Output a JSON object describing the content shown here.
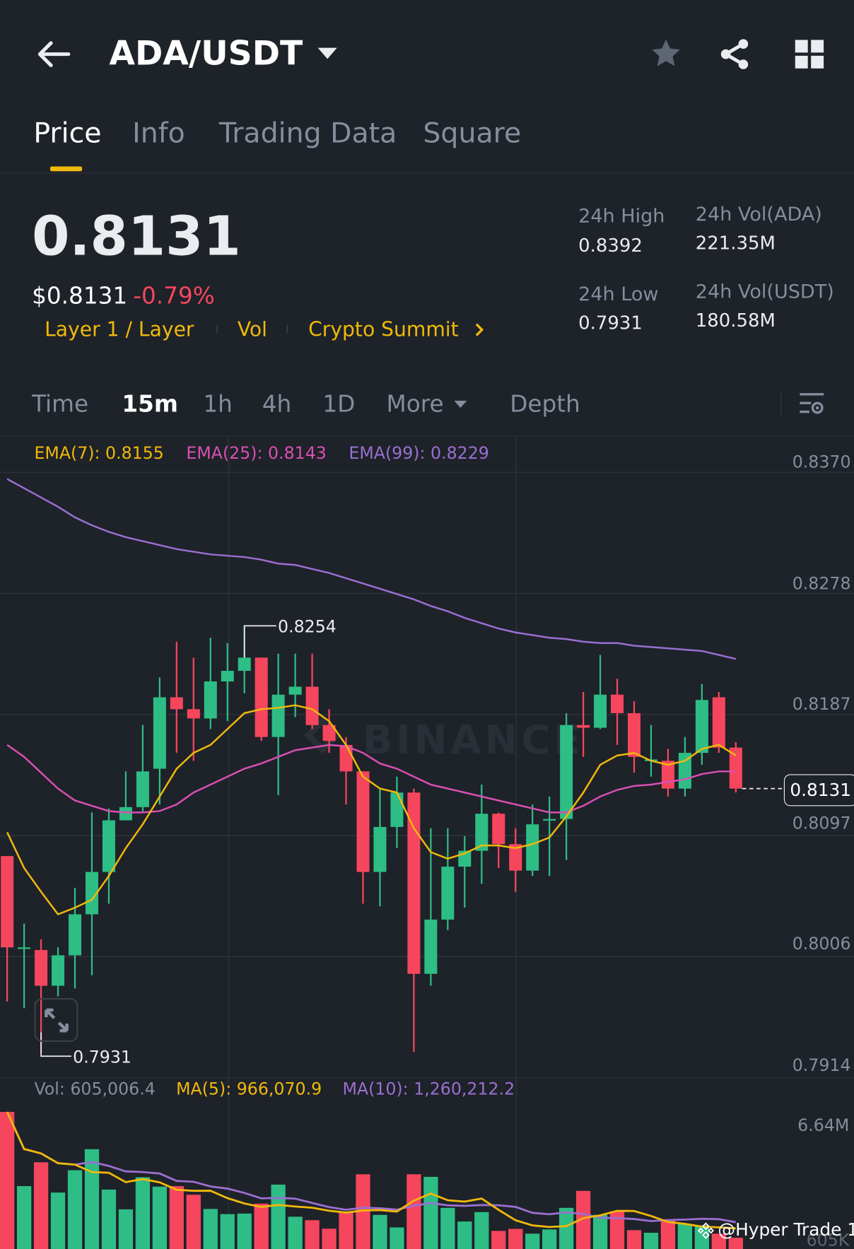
{
  "header": {
    "pair": "ADA/USDT",
    "icons": [
      "back-arrow-icon",
      "caret-down-icon",
      "star-icon",
      "share-icon",
      "grid-icon"
    ]
  },
  "tabs": [
    {
      "label": "Price",
      "active": true
    },
    {
      "label": "Info"
    },
    {
      "label": "Trading Data"
    },
    {
      "label": "Square"
    }
  ],
  "price": {
    "last": "0.8131",
    "usd": "$0.8131",
    "change": "-0.79%"
  },
  "tags": [
    "Layer 1 / Layer",
    "Vol",
    "Crypto Summit"
  ],
  "stats": {
    "high_label": "24h High",
    "high": "0.8392",
    "low_label": "24h Low",
    "low": "0.7931",
    "vol_ada_label": "24h Vol(ADA)",
    "vol_ada": "221.35M",
    "vol_usdt_label": "24h Vol(USDT)",
    "vol_usdt": "180.58M"
  },
  "intervals": {
    "time": "Time",
    "m15": "15m",
    "h1": "1h",
    "h4": "4h",
    "d1": "1D",
    "more": "More",
    "depth": "Depth",
    "selected": "15m"
  },
  "legend": {
    "ema7": "EMA(7): 0.8155",
    "ema25": "EMA(25): 0.8143",
    "ema99": "EMA(99): 0.8229"
  },
  "vol_legend": {
    "vol": "Vol: 605,006.4",
    "ma5": "MA(5): 966,070.9",
    "ma10": "MA(10): 1,260,212.2"
  },
  "colors": {
    "up": "#2ebd85",
    "down": "#f6465d",
    "ema7": "#f0b90b",
    "ema25": "#d94fb3",
    "ema99": "#9a6fd1",
    "accent": "#f0b90b"
  },
  "watermark": {
    "brand": "BINANCE",
    "credit": "@Hyper Trade 1"
  },
  "chart_data": {
    "type": "candlestick",
    "interval": "15m",
    "price_axis": {
      "ticks": [
        0.837,
        0.8278,
        0.8187,
        0.8097,
        0.8006,
        0.7914
      ],
      "labels": [
        "0.8370",
        "0.8278",
        "0.8187",
        "0.8097",
        "0.8006",
        "0.7914"
      ]
    },
    "current_price_label": "0.8131",
    "high_marker": "0.8254",
    "low_marker": "0.7931",
    "ohlc": [
      [
        0.808,
        0.808,
        0.797,
        0.8011
      ],
      [
        0.8011,
        0.8029,
        0.7965,
        0.8011
      ],
      [
        0.8009,
        0.8017,
        0.7931,
        0.7982
      ],
      [
        0.7982,
        0.8011,
        0.7974,
        0.8005
      ],
      [
        0.8005,
        0.8056,
        0.798,
        0.8036
      ],
      [
        0.8036,
        0.8113,
        0.799,
        0.8068
      ],
      [
        0.8068,
        0.8116,
        0.8044,
        0.8107
      ],
      [
        0.8107,
        0.8144,
        0.8107,
        0.8117
      ],
      [
        0.8117,
        0.8179,
        0.8113,
        0.8144
      ],
      [
        0.8146,
        0.8215,
        0.8119,
        0.82
      ],
      [
        0.82,
        0.8242,
        0.8158,
        0.8191
      ],
      [
        0.8191,
        0.823,
        0.8152,
        0.8184
      ],
      [
        0.8184,
        0.8245,
        0.8176,
        0.8212
      ],
      [
        0.8212,
        0.8241,
        0.8182,
        0.822
      ],
      [
        0.822,
        0.8254,
        0.8203,
        0.823
      ],
      [
        0.823,
        0.823,
        0.8167,
        0.817
      ],
      [
        0.817,
        0.8233,
        0.8126,
        0.8202
      ],
      [
        0.8202,
        0.8233,
        0.8185,
        0.8208
      ],
      [
        0.8208,
        0.8233,
        0.8176,
        0.8179
      ],
      [
        0.8179,
        0.8191,
        0.8158,
        0.8167
      ],
      [
        0.8164,
        0.817,
        0.8119,
        0.8144
      ],
      [
        0.8144,
        0.8144,
        0.8044,
        0.8068
      ],
      [
        0.8068,
        0.8131,
        0.8042,
        0.8102
      ],
      [
        0.8102,
        0.814,
        0.8086,
        0.8128
      ],
      [
        0.8128,
        0.8131,
        0.7932,
        0.7991
      ],
      [
        0.7991,
        0.8101,
        0.7982,
        0.8032
      ],
      [
        0.8032,
        0.8101,
        0.8024,
        0.8072
      ],
      [
        0.8072,
        0.8095,
        0.8041,
        0.8084
      ],
      [
        0.8084,
        0.8134,
        0.8059,
        0.8112
      ],
      [
        0.8112,
        0.8113,
        0.8071,
        0.8089
      ],
      [
        0.8089,
        0.8101,
        0.8053,
        0.8069
      ],
      [
        0.8069,
        0.8119,
        0.8065,
        0.8104
      ],
      [
        0.8107,
        0.8125,
        0.8065,
        0.8108
      ],
      [
        0.8108,
        0.8188,
        0.8077,
        0.8179
      ],
      [
        0.8179,
        0.8204,
        0.8155,
        0.8177
      ],
      [
        0.8177,
        0.8232,
        0.8176,
        0.8202
      ],
      [
        0.8202,
        0.8214,
        0.8164,
        0.8188
      ],
      [
        0.8188,
        0.8197,
        0.8143,
        0.8155
      ],
      [
        0.8152,
        0.8179,
        0.814,
        0.8153
      ],
      [
        0.8152,
        0.8161,
        0.8125,
        0.8131
      ],
      [
        0.8131,
        0.817,
        0.8125,
        0.8158
      ],
      [
        0.8158,
        0.821,
        0.8149,
        0.8198
      ],
      [
        0.82,
        0.8204,
        0.8158,
        0.8162
      ],
      [
        0.8162,
        0.8166,
        0.8128,
        0.8131
      ]
    ],
    "ema7": [
      0.8098,
      0.8071,
      0.8053,
      0.8036,
      0.8041,
      0.8047,
      0.8065,
      0.8086,
      0.8104,
      0.8125,
      0.8146,
      0.8158,
      0.8164,
      0.8176,
      0.8188,
      0.8191,
      0.8192,
      0.8194,
      0.8191,
      0.8182,
      0.8164,
      0.814,
      0.8131,
      0.8128,
      0.8101,
      0.8083,
      0.8078,
      0.8082,
      0.8088,
      0.8088,
      0.8086,
      0.8089,
      0.8094,
      0.811,
      0.8128,
      0.8149,
      0.8156,
      0.8158,
      0.8152,
      0.8149,
      0.8152,
      0.8161,
      0.8164,
      0.8156
    ],
    "ema25": [
      0.8164,
      0.8155,
      0.8143,
      0.8131,
      0.8122,
      0.8118,
      0.8114,
      0.8113,
      0.8113,
      0.8114,
      0.8119,
      0.8128,
      0.8134,
      0.814,
      0.8146,
      0.815,
      0.8155,
      0.816,
      0.8162,
      0.8164,
      0.8163,
      0.8158,
      0.815,
      0.8146,
      0.814,
      0.8134,
      0.8131,
      0.8128,
      0.8125,
      0.8122,
      0.8119,
      0.8116,
      0.8113,
      0.8113,
      0.8118,
      0.8125,
      0.813,
      0.8133,
      0.8134,
      0.8136,
      0.8138,
      0.8142,
      0.8144,
      0.8144
    ],
    "ema99": [
      0.8365,
      0.8358,
      0.8351,
      0.8344,
      0.8336,
      0.833,
      0.8325,
      0.8321,
      0.8318,
      0.8315,
      0.8312,
      0.831,
      0.8308,
      0.8307,
      0.8306,
      0.8304,
      0.8301,
      0.83,
      0.8297,
      0.8294,
      0.829,
      0.8286,
      0.8282,
      0.8278,
      0.8274,
      0.8269,
      0.8265,
      0.826,
      0.8256,
      0.8252,
      0.8249,
      0.8247,
      0.8245,
      0.8244,
      0.8242,
      0.8241,
      0.8241,
      0.8239,
      0.8238,
      0.8237,
      0.8236,
      0.8235,
      0.8232,
      0.8229
    ],
    "volume_axis": {
      "labels": [
        "6.64M",
        "605K"
      ]
    },
    "volume_millions": [
      7.43,
      3.41,
      4.7,
      3.06,
      4.27,
      5.41,
      3.22,
      2.15,
      3.89,
      3.38,
      3.41,
      2.94,
      2.17,
      1.89,
      1.92,
      2.46,
      3.49,
      1.75,
      1.56,
      1.1,
      1.98,
      4.05,
      1.85,
      1.17,
      4.05,
      3.91,
      2.23,
      1.49,
      2.0,
      0.98,
      1.09,
      0.83,
      1.06,
      2.23,
      3.15,
      1.85,
      2.04,
      1.02,
      0.88,
      1.53,
      1.34,
      1.28,
      0.83,
      0.61
    ]
  }
}
